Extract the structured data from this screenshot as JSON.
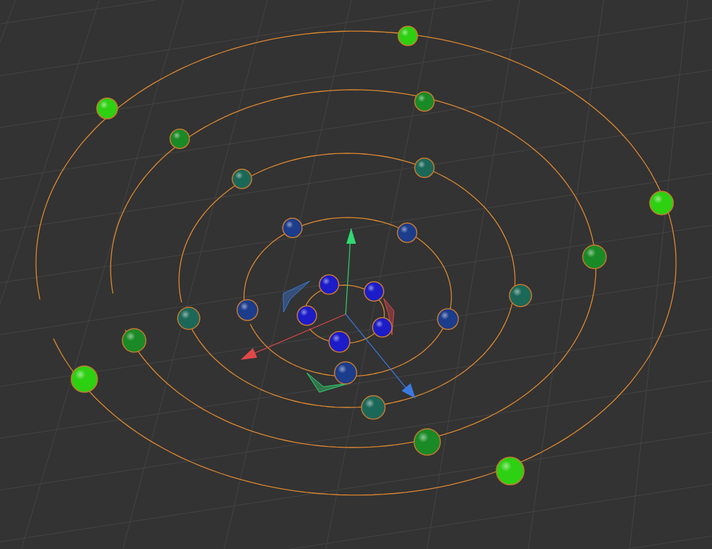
{
  "viewport": {
    "orbits": [
      {
        "color": "#1c1cc8"
      },
      {
        "color": "#1c3c8c"
      },
      {
        "color": "#1c6858"
      },
      {
        "color": "#1a8a26"
      },
      {
        "color": "#2ed012"
      }
    ]
  }
}
